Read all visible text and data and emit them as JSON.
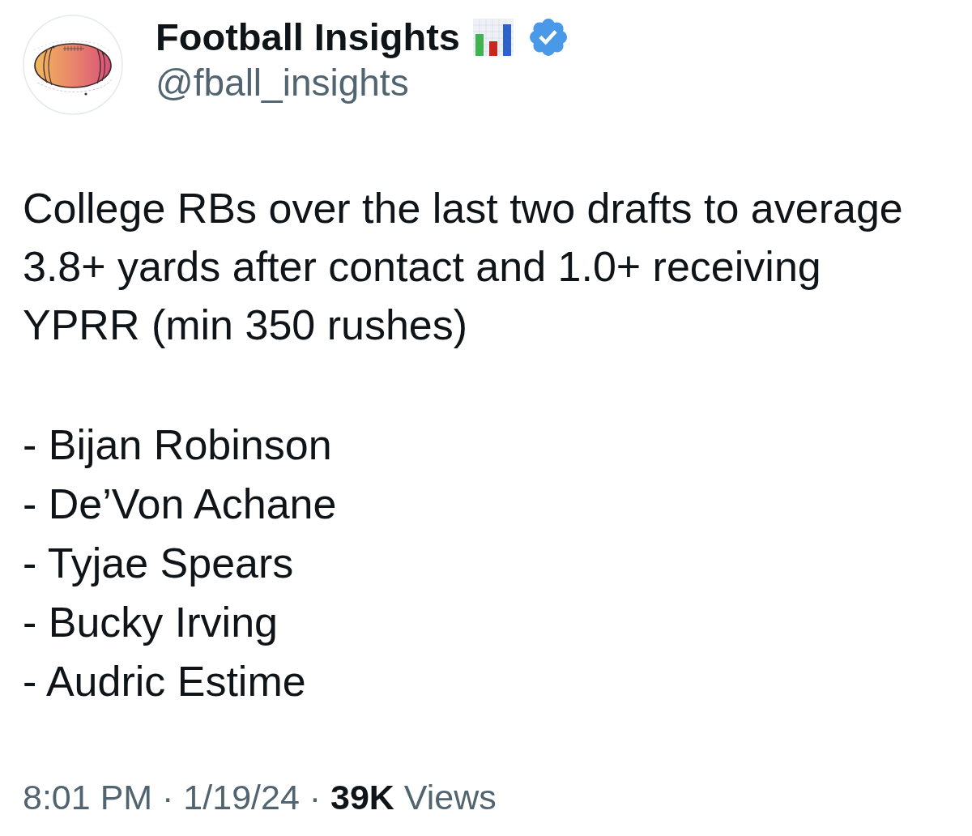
{
  "author": {
    "name": "Football Insights",
    "handle": "@fball_insights",
    "verified": true
  },
  "tweet": {
    "text": "College RBs over the last two drafts to average 3.8+ yards after contact and 1.0+ receiving YPRR (min 350 rushes)",
    "list": [
      "- Bijan Robinson",
      "- De’Von Achane",
      "- Tyjae Spears",
      "- Bucky Irving",
      "- Audric Estime"
    ]
  },
  "meta": "8:01 PM · 1/19/24 · **39K** Views"
}
